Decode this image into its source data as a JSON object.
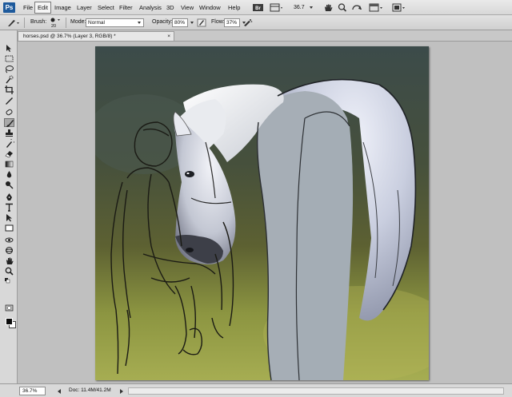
{
  "app": {
    "logo": "Ps",
    "menus": [
      "File",
      "Edit",
      "Image",
      "Layer",
      "Select",
      "Filter",
      "Analysis",
      "3D",
      "View",
      "Window",
      "Help"
    ],
    "active_menu": "Edit",
    "zoom_value": "36.7"
  },
  "options_bar": {
    "brush_label": "Brush:",
    "brush_size": "20",
    "mode_label": "Mode:",
    "mode_value": "Normal",
    "opacity_label": "Opacity:",
    "opacity_value": "80%",
    "flow_label": "Flow:",
    "flow_value": "37%"
  },
  "document": {
    "tab_title": "horses.psd @ 36.7% (Layer 3, RGB/8) *",
    "tab_close": "×"
  },
  "status_bar": {
    "zoom": "36.7%",
    "doc_size": "Doc: 11.4M/41.2M"
  },
  "colors": {
    "foreground": "#0c0c0c",
    "background": "#ffffff",
    "accent": "#1e5a9c"
  }
}
